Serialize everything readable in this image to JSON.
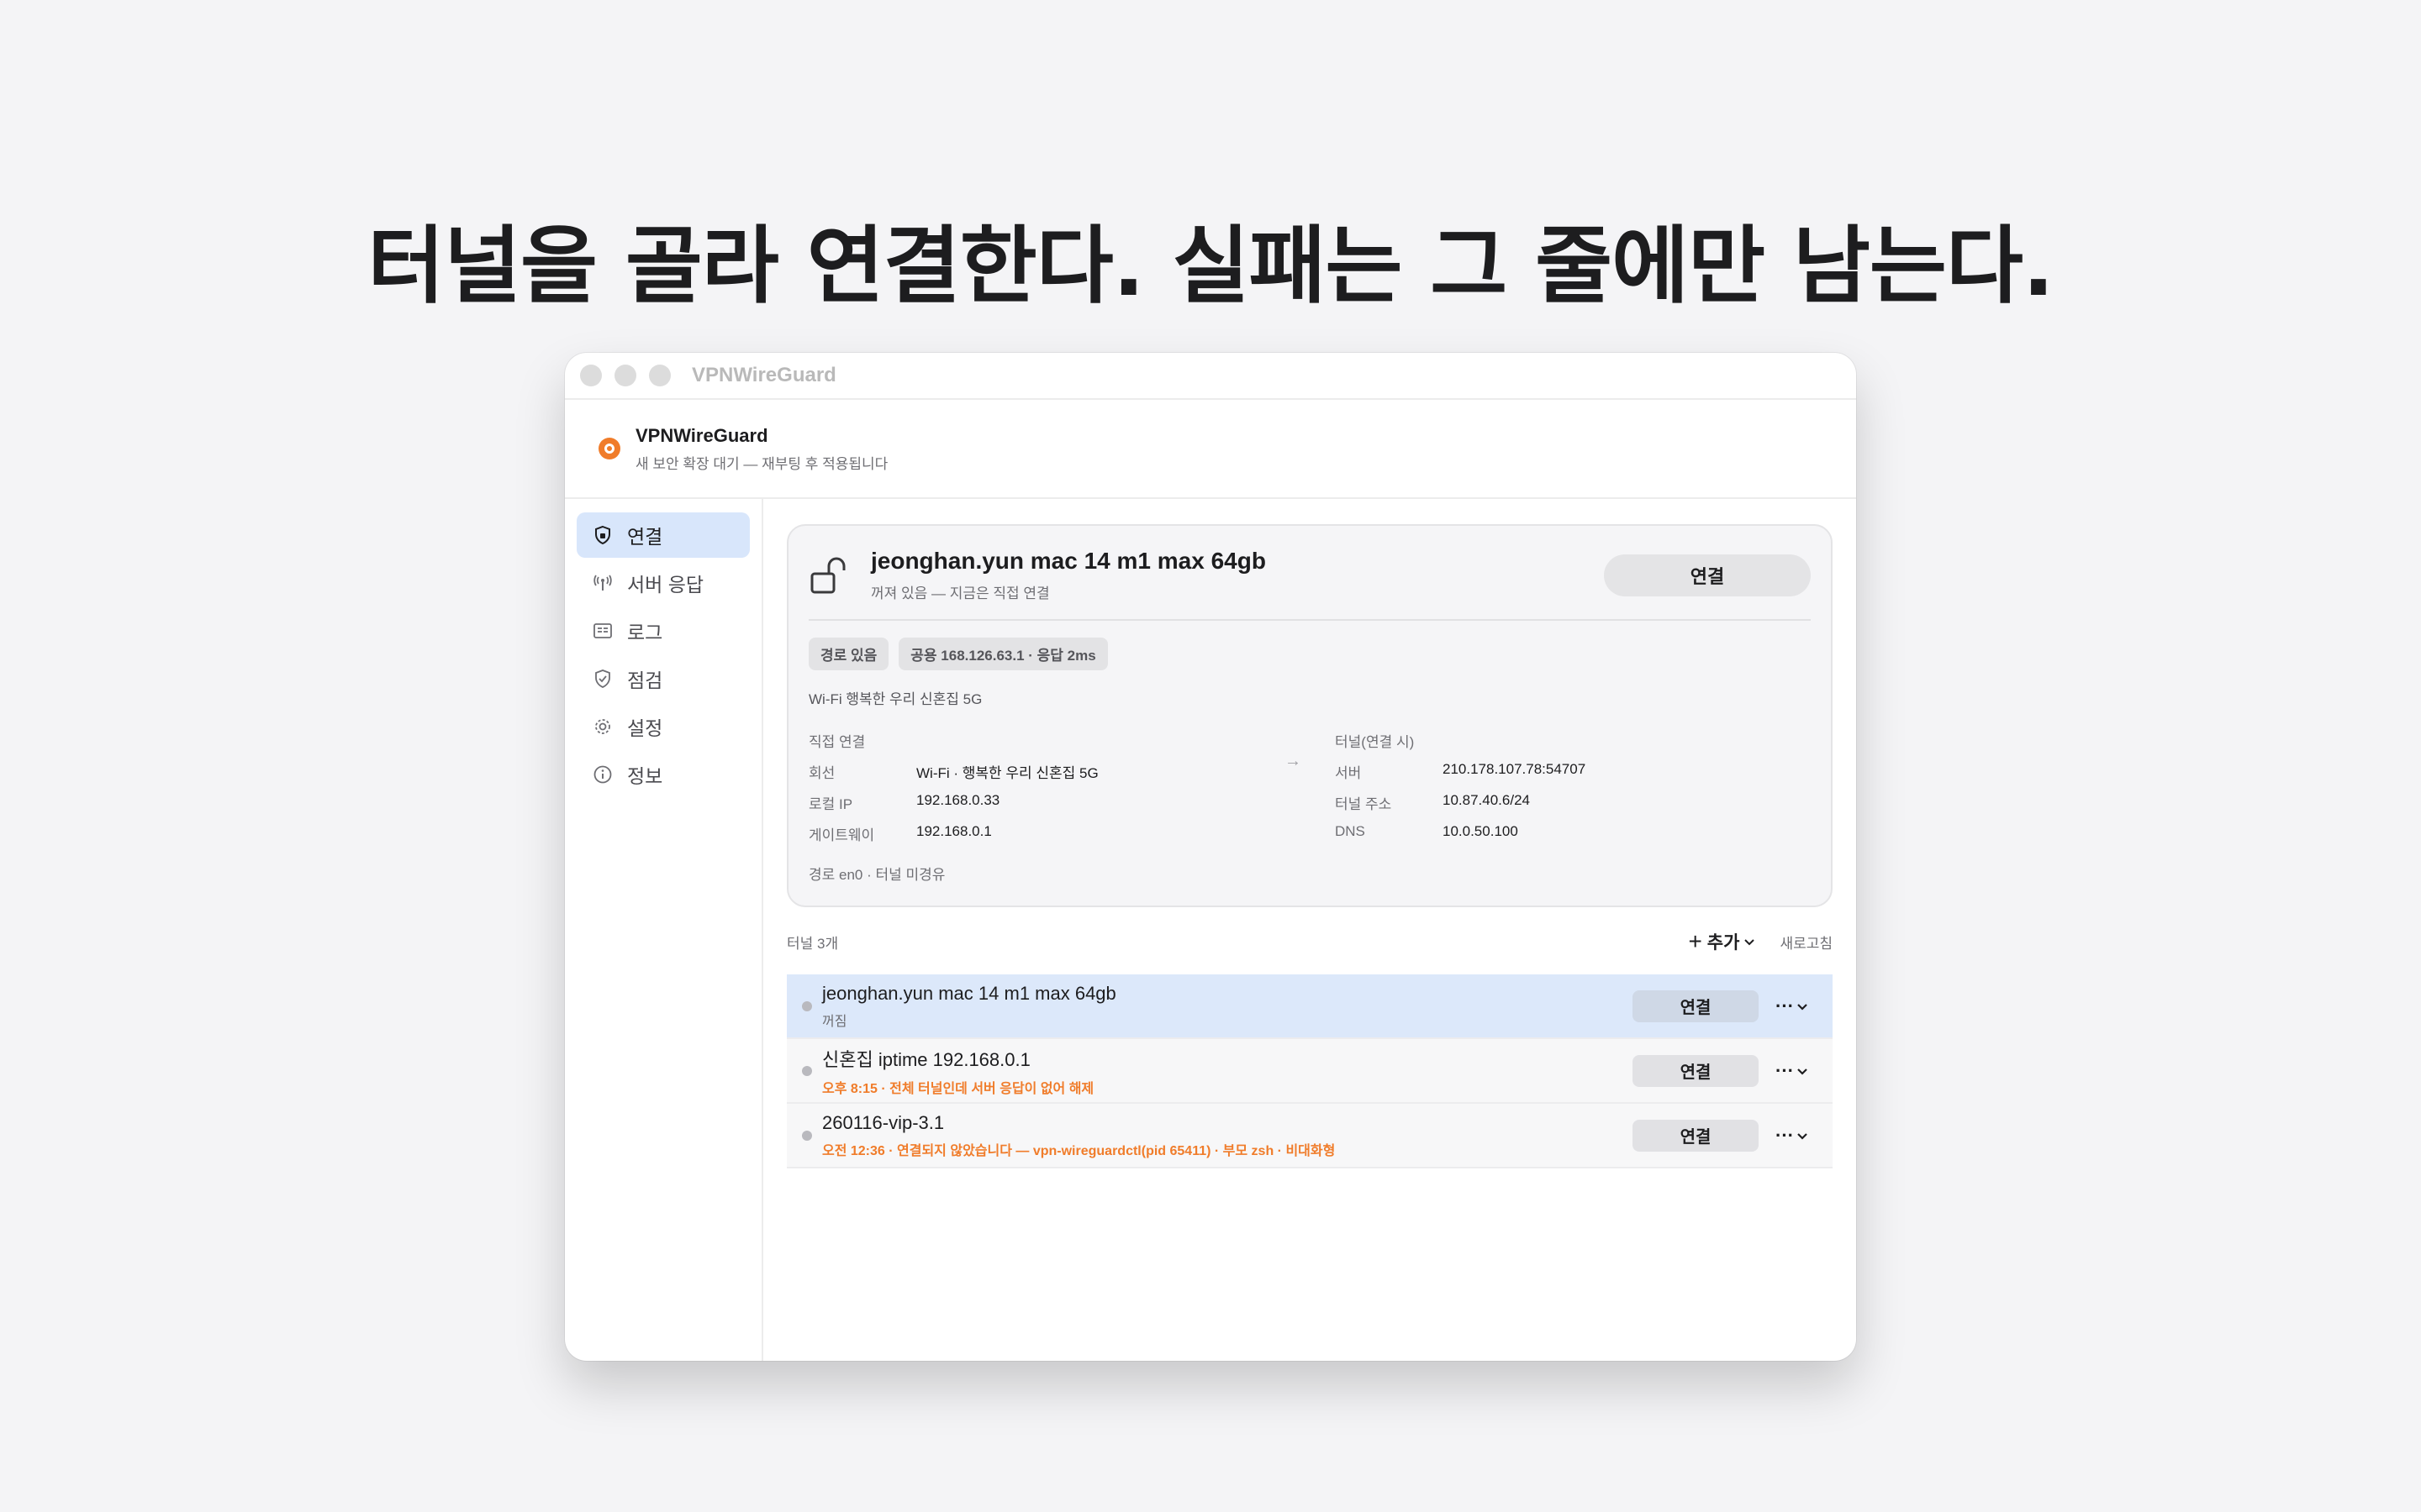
{
  "headline": "터널을 골라 연결한다. 실패는 그 줄에만 남는다.",
  "window": {
    "title": "VPNWireGuard"
  },
  "app": {
    "name": "VPNWireGuard",
    "subtitle": "새 보안 확장 대기 — 재부팅 후 적용됩니다",
    "accent": "#f07c2a"
  },
  "sidebar": {
    "items": [
      {
        "label": "연결",
        "icon": "shield-icon",
        "active": true
      },
      {
        "label": "서버 응답",
        "icon": "antenna-icon"
      },
      {
        "label": "로그",
        "icon": "log-icon"
      },
      {
        "label": "점검",
        "icon": "check-shield-icon"
      },
      {
        "label": "설정",
        "icon": "gear-icon"
      },
      {
        "label": "정보",
        "icon": "info-icon"
      }
    ]
  },
  "current": {
    "name": "jeonghan.yun mac 14 m1 max 64gb",
    "status": "꺼져 있음 — 지금은 직접 연결",
    "connect_label": "연결",
    "pills": [
      "경로 있음",
      "공용 168.126.63.1 · 응답 2ms"
    ],
    "wifi": "Wi-Fi 행복한 우리 신혼집 5G",
    "direct": {
      "heading": "직접 연결",
      "rows": [
        {
          "k": "회선",
          "v": "Wi-Fi · 행복한 우리 신혼집 5G"
        },
        {
          "k": "로컬 IP",
          "v": "192.168.0.33"
        },
        {
          "k": "게이트웨이",
          "v": "192.168.0.1"
        }
      ]
    },
    "arrow": "→",
    "tunnel": {
      "heading": "터널(연결 시)",
      "rows": [
        {
          "k": "서버",
          "v": "210.178.107.78:54707"
        },
        {
          "k": "터널 주소",
          "v": "10.87.40.6/24"
        },
        {
          "k": "DNS",
          "v": "10.0.50.100"
        }
      ]
    },
    "route": "경로 en0 · 터널 미경유"
  },
  "list": {
    "count": "터널 3개",
    "add_label": "추가",
    "refresh_label": "새로고침",
    "tunnels": [
      {
        "name": "jeonghan.yun mac 14 m1 max 64gb",
        "status": "꺼짐",
        "error": false,
        "connect": "연결",
        "more": "···"
      },
      {
        "name": "신혼집 iptime 192.168.0.1",
        "status": "오후 8:15 · 전체 터널인데 서버 응답이 없어 해제",
        "error": true,
        "connect": "연결",
        "more": "···"
      },
      {
        "name": "260116-vip-3.1",
        "status": "오전 12:36 · 연결되지 않았습니다 — vpn-wireguardctl(pid 65411) · 부모 zsh · 비대화형",
        "error": true,
        "connect": "연결",
        "more": "···"
      }
    ]
  }
}
